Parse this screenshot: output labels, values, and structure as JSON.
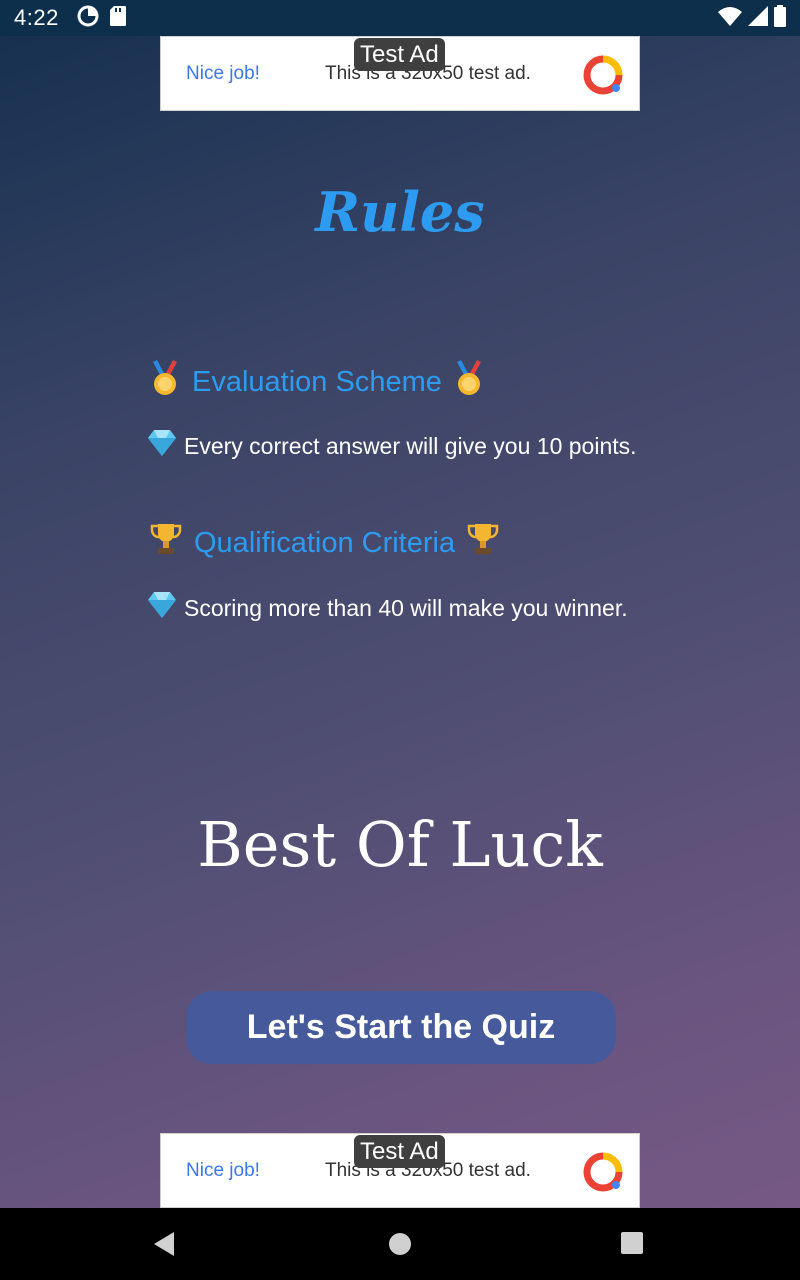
{
  "status_bar": {
    "time": "4:22",
    "icons": [
      "data-saver-icon",
      "sd-card-icon",
      "wifi-icon",
      "signal-icon",
      "battery-icon"
    ]
  },
  "ads": {
    "top": {
      "tag": "Test Ad",
      "headline": "Nice job!",
      "body": "This is a 320x50 test ad.",
      "logo": "ad-logo-icon"
    },
    "bottom": {
      "tag": "Test Ad",
      "headline": "Nice job!",
      "body": "This is a 320x50 test ad.",
      "logo": "ad-logo-icon"
    }
  },
  "rules": {
    "title": "Rules",
    "evaluation": {
      "heading": "Evaluation Scheme",
      "heading_icon": "medal-icon",
      "rule": "Every correct answer will give you 10 points.",
      "rule_icon": "diamond-icon"
    },
    "qualification": {
      "heading": "Qualification Criteria",
      "heading_icon": "trophy-icon",
      "rule": "Scoring more than 40 will make you winner.",
      "rule_icon": "diamond-icon"
    }
  },
  "closing_text": "Best Of Luck",
  "start_button": {
    "label": "Let's Start the Quiz"
  },
  "nav_bar": {
    "icons": [
      "back-icon",
      "home-icon",
      "recents-icon"
    ]
  },
  "colors": {
    "accent": "#2d9cf0",
    "button": "#46599a",
    "status_bar": "#0e2f4c"
  }
}
